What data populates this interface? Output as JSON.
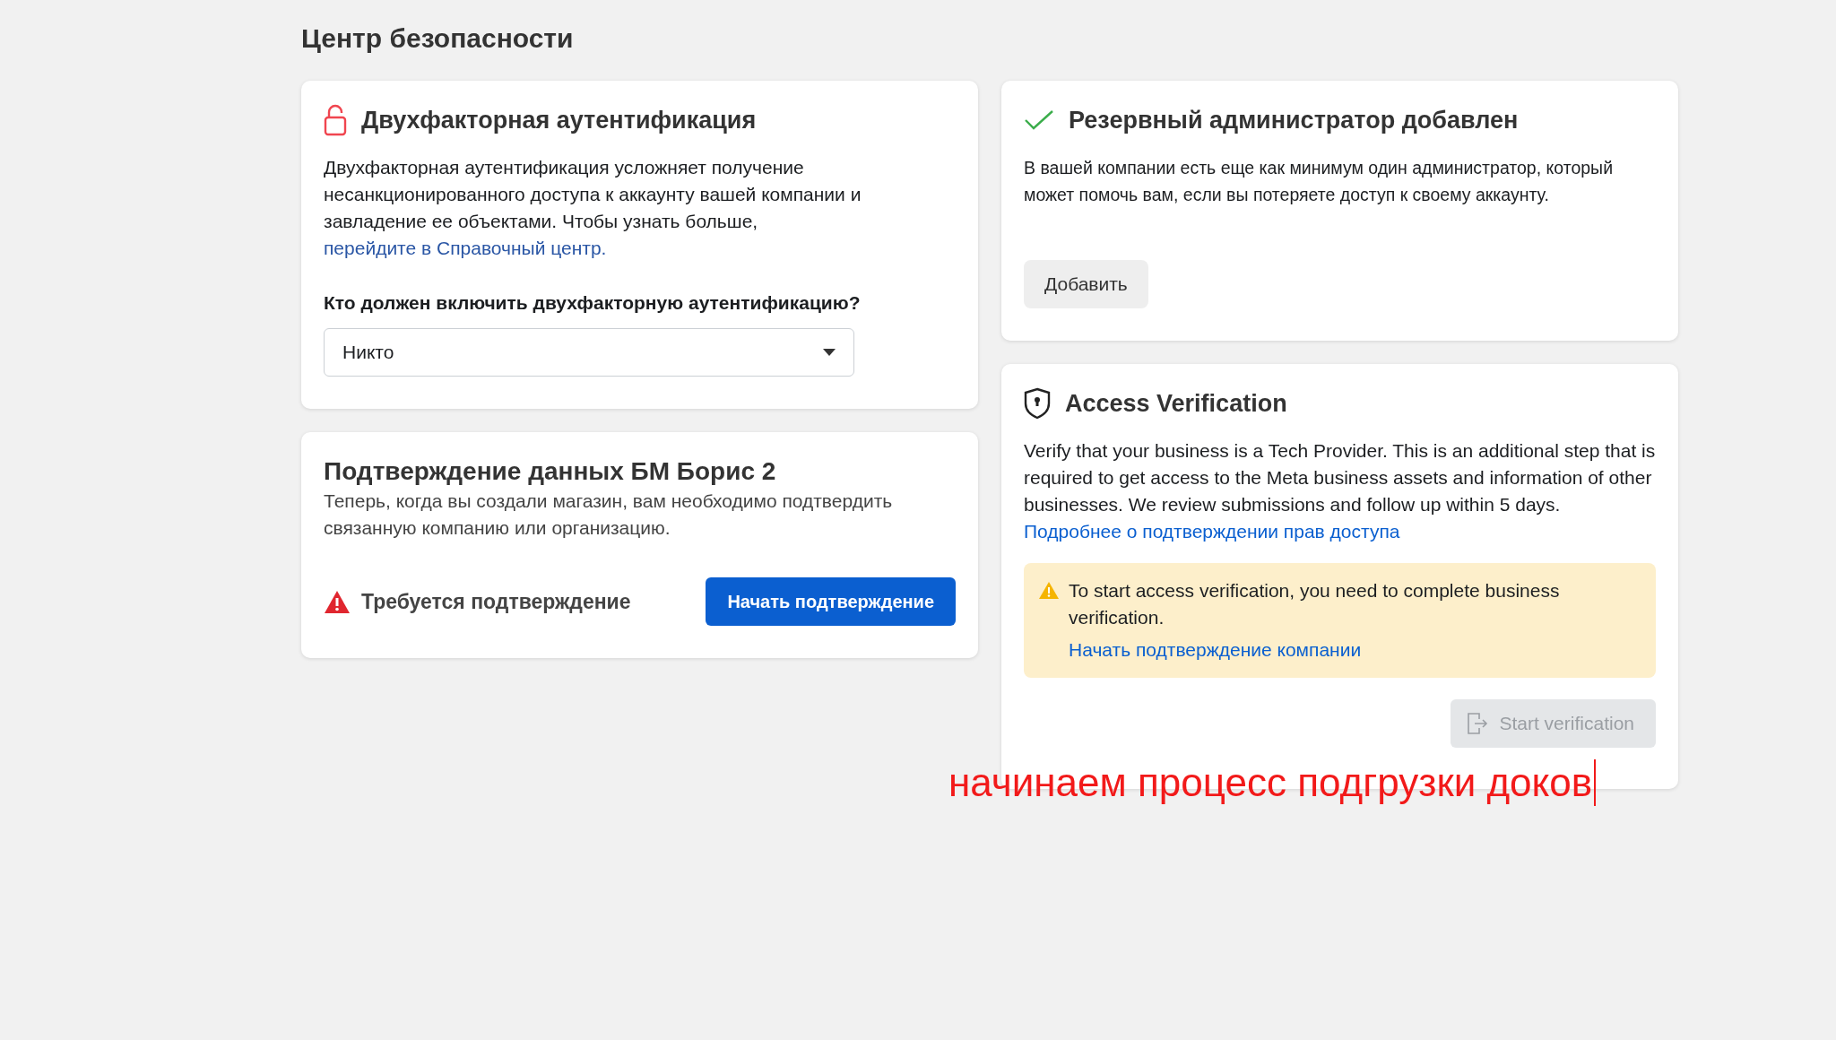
{
  "page_title": "Центр безопасности",
  "two_factor": {
    "title": "Двухфакторная аутентификация",
    "text": "Двухфакторная аутентификация усложняет получение несанкционированного доступа к аккаунту вашей компании и завладение ее объектами. Чтобы узнать больше,",
    "link": "перейдите в Справочный центр.",
    "question": "Кто должен включить двухфакторную аутентификацию?",
    "dropdown": {
      "value": "Никто"
    }
  },
  "data_confirmation": {
    "title": "Подтверждение данных БМ Борис 2",
    "text": "Теперь, когда вы создали магазин, вам необходимо подтвердить связанную компанию или организацию.",
    "status": "Требуется подтверждение",
    "button": "Начать подтверждение"
  },
  "backup_admin": {
    "title": "Резервный администратор добавлен",
    "text": "В вашей компании есть еще как минимум один администратор, который может помочь вам, если вы потеряете доступ к своему аккаунту.",
    "button": "Добавить"
  },
  "access_verification": {
    "title": "Access Verification",
    "text": "Verify that your business is a Tech Provider. This is an additional step that is required to get access to the Meta business assets and information of other businesses. We review submissions and follow up within 5 days.",
    "link": "Подробнее о подтверждении прав доступа",
    "notice": {
      "text": "To start access verification, you need to complete business verification.",
      "link": "Начать подтверждение компании"
    },
    "button": {
      "label": "Start verification",
      "disabled": true
    }
  },
  "annotation": "начинаем процесс подгрузки доков"
}
